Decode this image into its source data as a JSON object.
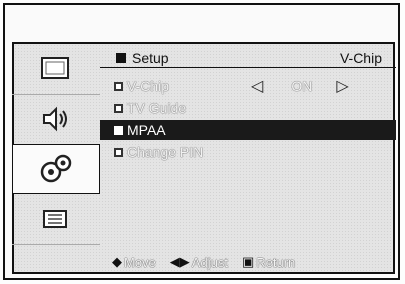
{
  "menu": {
    "title": "Setup",
    "current_item": "V-Chip",
    "items": [
      {
        "label": "V-Chip",
        "value": "ON"
      },
      {
        "label": "TV Guide"
      },
      {
        "label": "MPAA",
        "selected": true
      },
      {
        "label": "Change PIN"
      }
    ]
  },
  "tabs": [
    {
      "icon": "picture-icon"
    },
    {
      "icon": "sound-icon"
    },
    {
      "icon": "setup-icon",
      "active": true
    },
    {
      "icon": "input-icon"
    }
  ],
  "footer": {
    "move": "Move",
    "adjust": "Adjust",
    "return": "Return"
  },
  "colors": {
    "highlight": "#1a1a1a",
    "background": "#e4e4e4"
  }
}
